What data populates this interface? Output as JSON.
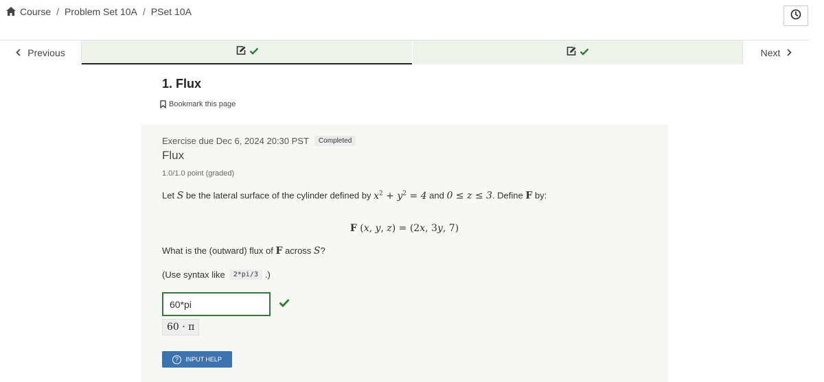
{
  "breadcrumb": {
    "items": [
      "Course",
      "Problem Set 10A",
      "PSet 10A"
    ],
    "separator": "/"
  },
  "icons": {
    "home": "home-icon",
    "clock": "clock-icon",
    "edit": "edit-icon",
    "check": "check-icon",
    "bookmark": "bookmark-icon",
    "help": "question-circle-icon"
  },
  "sequence_nav": {
    "previous_label": "Previous",
    "next_label": "Next",
    "tabs": [
      {
        "status": "completed",
        "active": true
      },
      {
        "status": "completed",
        "active": false
      }
    ]
  },
  "unit": {
    "title": "1. Flux",
    "bookmark_label": "Bookmark this page"
  },
  "problem": {
    "due": "Exercise due Dec 6, 2024 20:30 PST",
    "status_badge": "Completed",
    "title": "Flux",
    "points": "1.0/1.0 point (graded)",
    "statement": {
      "t1": "Let ",
      "S": "S",
      "t2": " be the lateral surface of the cylinder defined by ",
      "t3": " and ",
      "t4": ". Define ",
      "F": "F",
      "t5": " by:"
    },
    "question": {
      "t1": "What is the (outward) flux of ",
      "F": "F",
      "t2": " across ",
      "S": "S",
      "t3": "?"
    },
    "syntax": {
      "prefix": "(Use syntax like",
      "code": "2*pi/3",
      "suffix": ".)"
    },
    "answer_value": "60*pi",
    "answer_correct": true,
    "preview": "60 · π",
    "help_label": "INPUT HELP"
  },
  "colors": {
    "tab_bg": "#edf3ea",
    "correct_green": "#2e7d32",
    "button_blue": "#3d72b0",
    "card_bg": "#f7f7f4"
  }
}
